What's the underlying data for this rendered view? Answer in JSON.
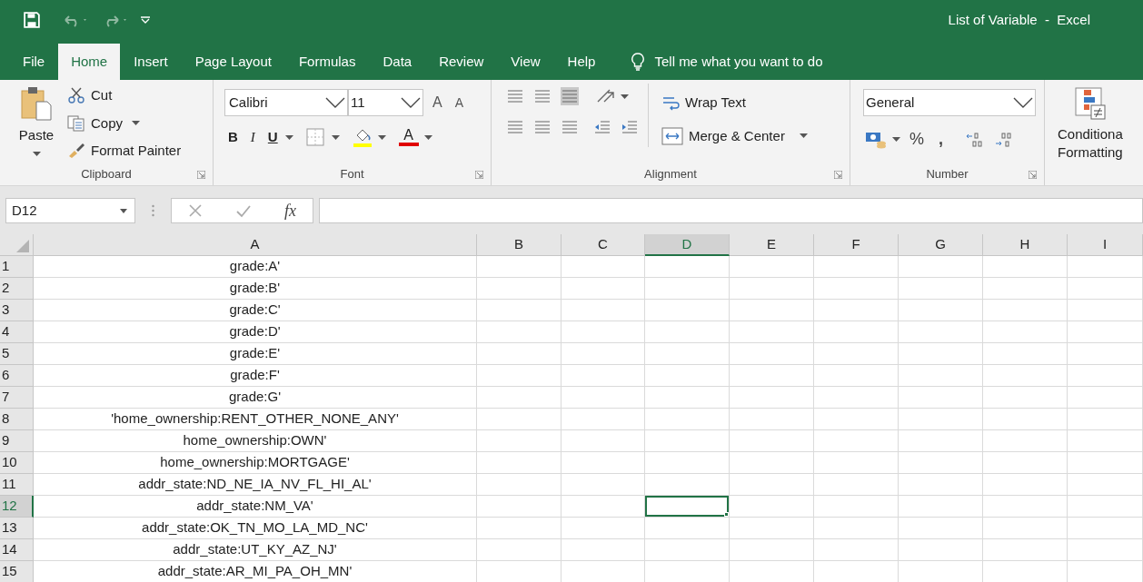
{
  "window": {
    "title": "List of Variable  -  Excel"
  },
  "tabs": [
    {
      "label": "File",
      "selected": false
    },
    {
      "label": "Home",
      "selected": true
    },
    {
      "label": "Insert",
      "selected": false
    },
    {
      "label": "Page Layout",
      "selected": false
    },
    {
      "label": "Formulas",
      "selected": false
    },
    {
      "label": "Data",
      "selected": false
    },
    {
      "label": "Review",
      "selected": false
    },
    {
      "label": "View",
      "selected": false
    },
    {
      "label": "Help",
      "selected": false
    }
  ],
  "tell_me": {
    "placeholder": "Tell me what you want to do"
  },
  "ribbon": {
    "clipboard": {
      "paste": "Paste",
      "cut": "Cut",
      "copy": "Copy",
      "format_painter": "Format Painter",
      "label": "Clipboard"
    },
    "font": {
      "font_name": "Calibri",
      "font_size": "11",
      "grow_font": "A",
      "shrink_font": "A",
      "bold": "B",
      "italic": "I",
      "underline": "U",
      "font_color": "A",
      "label": "Font"
    },
    "alignment": {
      "wrap_text": "Wrap Text",
      "merge_center": "Merge & Center",
      "label": "Alignment"
    },
    "number": {
      "format": "General",
      "percent": "%",
      "comma": ",",
      "label": "Number"
    },
    "styles": {
      "conditional_formatting": [
        "Conditiona",
        "Formatting"
      ]
    }
  },
  "name_box": {
    "value": "D12"
  },
  "formula_bar": {
    "function_label": "fx"
  },
  "sheet": {
    "columns": [
      {
        "label": "A",
        "selected": false
      },
      {
        "label": "B",
        "selected": false
      },
      {
        "label": "C",
        "selected": false
      },
      {
        "label": "D",
        "selected": true
      },
      {
        "label": "E",
        "selected": false
      },
      {
        "label": "F",
        "selected": false
      },
      {
        "label": "G",
        "selected": false
      },
      {
        "label": "H",
        "selected": false
      },
      {
        "label": "I",
        "selected": false
      }
    ],
    "rows": [
      {
        "number": "1",
        "value": "grade:A'",
        "selected": false
      },
      {
        "number": "2",
        "value": "grade:B'",
        "selected": false
      },
      {
        "number": "3",
        "value": "grade:C'",
        "selected": false
      },
      {
        "number": "4",
        "value": "grade:D'",
        "selected": false
      },
      {
        "number": "5",
        "value": "grade:E'",
        "selected": false
      },
      {
        "number": "6",
        "value": "grade:F'",
        "selected": false
      },
      {
        "number": "7",
        "value": "grade:G'",
        "selected": false
      },
      {
        "number": "8",
        "value": "'home_ownership:RENT_OTHER_NONE_ANY'",
        "selected": false
      },
      {
        "number": "9",
        "value": "home_ownership:OWN'",
        "selected": false
      },
      {
        "number": "10",
        "value": "home_ownership:MORTGAGE'",
        "selected": false
      },
      {
        "number": "11",
        "value": "addr_state:ND_NE_IA_NV_FL_HI_AL'",
        "selected": false
      },
      {
        "number": "12",
        "value": "addr_state:NM_VA'",
        "selected": true
      },
      {
        "number": "13",
        "value": "addr_state:OK_TN_MO_LA_MD_NC'",
        "selected": false
      },
      {
        "number": "14",
        "value": "addr_state:UT_KY_AZ_NJ'",
        "selected": false
      },
      {
        "number": "15",
        "value": "addr_state:AR_MI_PA_OH_MN'",
        "selected": false
      }
    ]
  }
}
